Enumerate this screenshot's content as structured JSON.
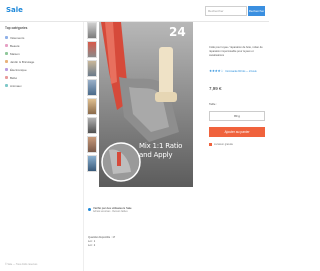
{
  "header": {
    "logo": "Sale",
    "search_placeholder": "Rechercher",
    "search_button": "Rechercher"
  },
  "sidebar": {
    "title": "Top catégories",
    "items": [
      {
        "label": "Vêtements",
        "color": "#8fb0e8"
      },
      {
        "label": "Beauté",
        "color": "#e6a0c4"
      },
      {
        "label": "Maison",
        "color": "#8fc79a"
      },
      {
        "label": "Jardin & Bricolage",
        "color": "#e8b27a"
      },
      {
        "label": "Électronique",
        "color": "#b99be0"
      },
      {
        "label": "Bébé",
        "color": "#e89a9a"
      },
      {
        "label": "Animaux",
        "color": "#7fc8c8"
      }
    ]
  },
  "image": {
    "number": "24",
    "caption_line1": "Mix 1:1 Ratio",
    "caption_line2": "and Apply"
  },
  "product": {
    "description": "Colle pour tuyau / réparation de fuite, ruban de réparation imperméable pour tuyaux et canalisations",
    "stars": "★★★★☆",
    "rating_text": "Commandé 84 fois — 24 avis",
    "price": "7,99 €",
    "size_label": "Taille :",
    "size_value": "80 g",
    "add_to_cart": "Ajouter au panier",
    "shipping": "Livraison gratuite"
  },
  "verified": {
    "title": "Vérifié par des utilisateurs Sale",
    "subtitle": "Achats sécurisés · Retours faciles"
  },
  "details": {
    "line1": "Quantité disponible : 17",
    "line2": "Lot : 1",
    "line3": "Lot : 2"
  },
  "footer": {
    "text": "© Sale — Tous droits réservés"
  }
}
